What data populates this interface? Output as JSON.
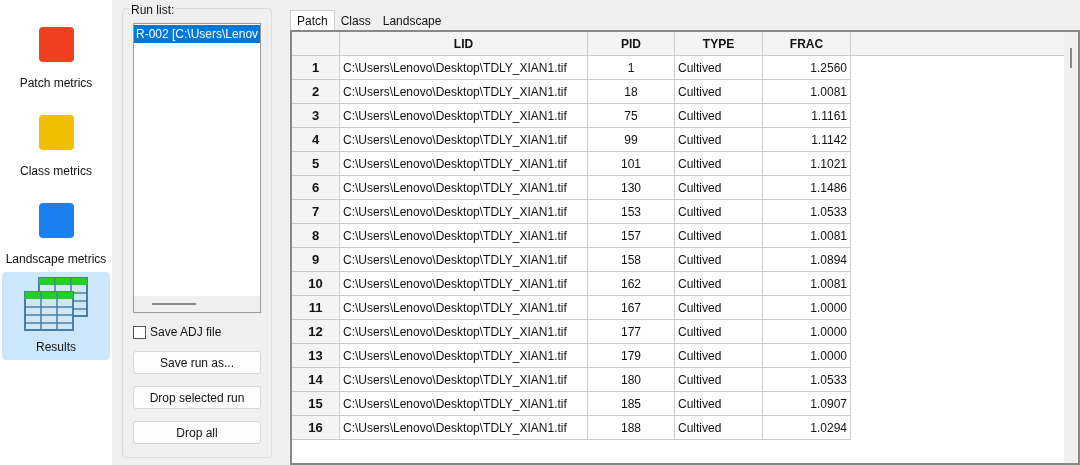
{
  "sidebar": {
    "items": [
      {
        "label": "Patch metrics",
        "kind": "square",
        "color": "#f04020",
        "selected": false
      },
      {
        "label": "Class metrics",
        "kind": "square",
        "color": "#f0c000",
        "selected": false
      },
      {
        "label": "Landscape metrics",
        "kind": "square",
        "color": "#1a80f0",
        "selected": false
      },
      {
        "label": "Results",
        "kind": "table",
        "selected": true
      }
    ]
  },
  "run_list": {
    "title": "Run list:",
    "items": [
      {
        "label": "R-002 [C:\\Users\\Lenov",
        "selected": true
      }
    ]
  },
  "save_adj": {
    "label": "Save ADJ file",
    "checked": false
  },
  "buttons": [
    "Save run as...",
    "Drop selected run",
    "Drop all"
  ],
  "tabs": [
    {
      "label": "Patch",
      "selected": true
    },
    {
      "label": "Class",
      "selected": false
    },
    {
      "label": "Landscape",
      "selected": false
    }
  ],
  "table": {
    "columns": [
      "LID",
      "PID",
      "TYPE",
      "FRAC"
    ],
    "rows": [
      {
        "n": "1",
        "cells": [
          "C:\\Users\\Lenovo\\Desktop\\TDLY_XIAN1.tif",
          "1",
          "Cultived",
          "1.2560"
        ]
      },
      {
        "n": "2",
        "cells": [
          "C:\\Users\\Lenovo\\Desktop\\TDLY_XIAN1.tif",
          "18",
          "Cultived",
          "1.0081"
        ]
      },
      {
        "n": "3",
        "cells": [
          "C:\\Users\\Lenovo\\Desktop\\TDLY_XIAN1.tif",
          "75",
          "Cultived",
          "1.1161"
        ]
      },
      {
        "n": "4",
        "cells": [
          "C:\\Users\\Lenovo\\Desktop\\TDLY_XIAN1.tif",
          "99",
          "Cultived",
          "1.1142"
        ]
      },
      {
        "n": "5",
        "cells": [
          "C:\\Users\\Lenovo\\Desktop\\TDLY_XIAN1.tif",
          "101",
          "Cultived",
          "1.1021"
        ]
      },
      {
        "n": "6",
        "cells": [
          "C:\\Users\\Lenovo\\Desktop\\TDLY_XIAN1.tif",
          "130",
          "Cultived",
          "1.1486"
        ]
      },
      {
        "n": "7",
        "cells": [
          "C:\\Users\\Lenovo\\Desktop\\TDLY_XIAN1.tif",
          "153",
          "Cultived",
          "1.0533"
        ]
      },
      {
        "n": "8",
        "cells": [
          "C:\\Users\\Lenovo\\Desktop\\TDLY_XIAN1.tif",
          "157",
          "Cultived",
          "1.0081"
        ]
      },
      {
        "n": "9",
        "cells": [
          "C:\\Users\\Lenovo\\Desktop\\TDLY_XIAN1.tif",
          "158",
          "Cultived",
          "1.0894"
        ]
      },
      {
        "n": "10",
        "cells": [
          "C:\\Users\\Lenovo\\Desktop\\TDLY_XIAN1.tif",
          "162",
          "Cultived",
          "1.0081"
        ]
      },
      {
        "n": "11",
        "cells": [
          "C:\\Users\\Lenovo\\Desktop\\TDLY_XIAN1.tif",
          "167",
          "Cultived",
          "1.0000"
        ]
      },
      {
        "n": "12",
        "cells": [
          "C:\\Users\\Lenovo\\Desktop\\TDLY_XIAN1.tif",
          "177",
          "Cultived",
          "1.0000"
        ]
      },
      {
        "n": "13",
        "cells": [
          "C:\\Users\\Lenovo\\Desktop\\TDLY_XIAN1.tif",
          "179",
          "Cultived",
          "1.0000"
        ]
      },
      {
        "n": "14",
        "cells": [
          "C:\\Users\\Lenovo\\Desktop\\TDLY_XIAN1.tif",
          "180",
          "Cultived",
          "1.0533"
        ]
      },
      {
        "n": "15",
        "cells": [
          "C:\\Users\\Lenovo\\Desktop\\TDLY_XIAN1.tif",
          "185",
          "Cultived",
          "1.0907"
        ]
      },
      {
        "n": "16",
        "cells": [
          "C:\\Users\\Lenovo\\Desktop\\TDLY_XIAN1.tif",
          "188",
          "Cultived",
          "1.0294"
        ]
      }
    ]
  }
}
